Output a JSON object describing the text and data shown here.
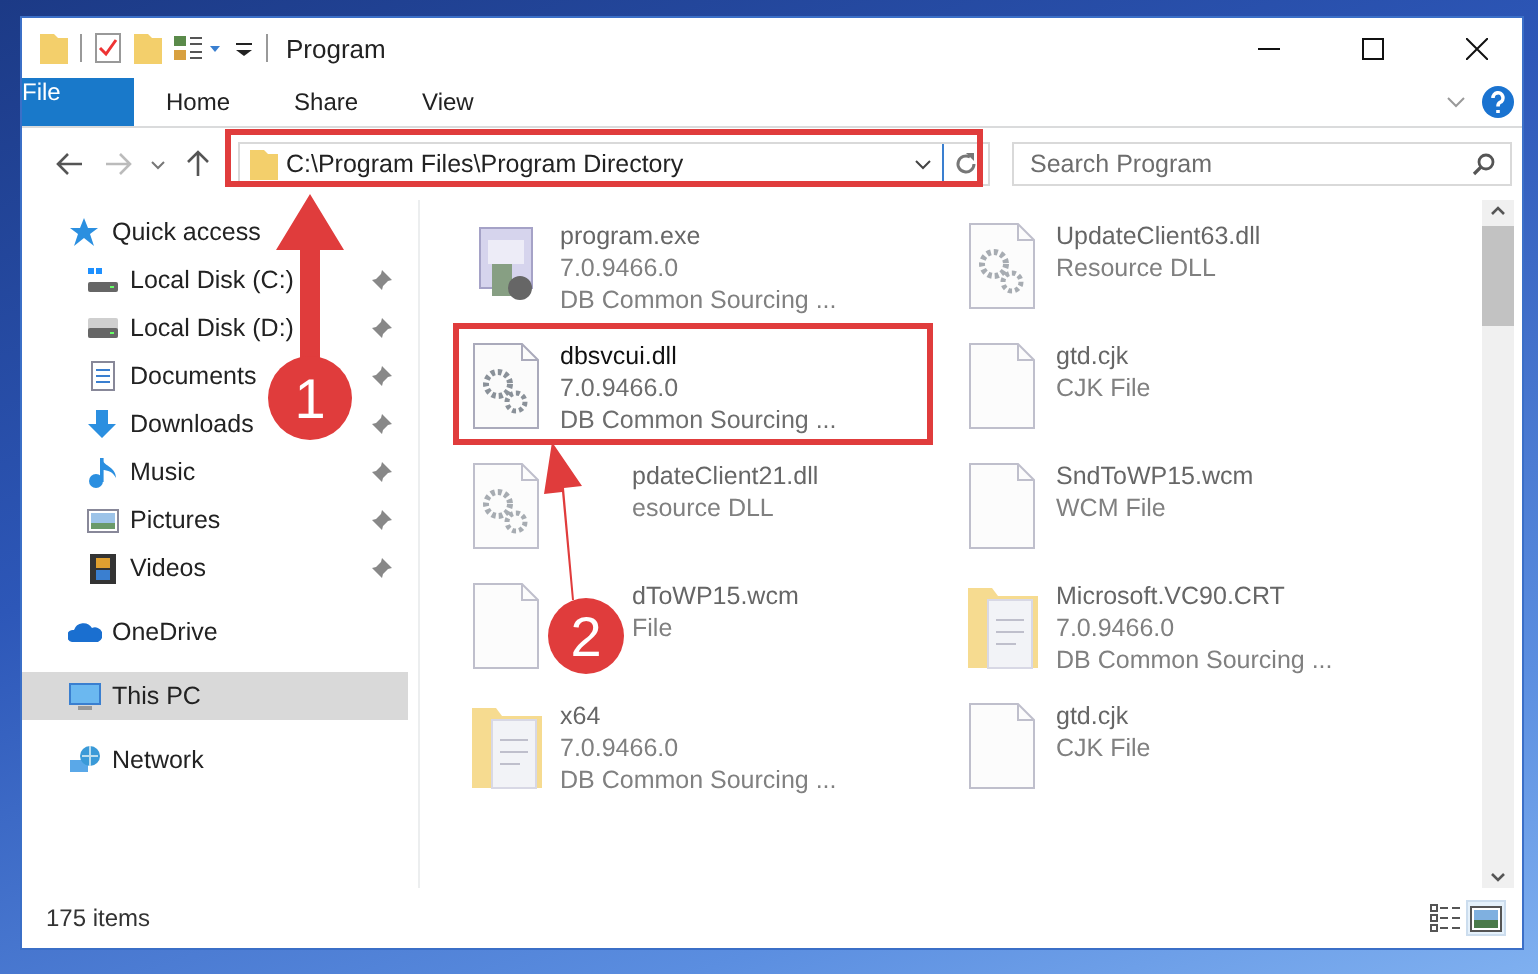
{
  "window": {
    "title": "Program"
  },
  "ribbon": {
    "tabs": [
      {
        "label": "File",
        "kind": "file",
        "selected": false
      },
      {
        "label": "Home",
        "kind": "tab",
        "selected": false
      },
      {
        "label": "Share",
        "kind": "tab",
        "selected": false
      },
      {
        "label": "View",
        "kind": "tab",
        "selected": false
      }
    ]
  },
  "address": {
    "path": "C:\\Program Files\\Program Directory"
  },
  "search": {
    "placeholder": "Search Program"
  },
  "sidebar": {
    "items": [
      {
        "label": "Quick access",
        "kind": "star",
        "selected": false,
        "children": [
          {
            "label": "Local Disk (C:)",
            "kind": "disk-windows",
            "pinned": true,
            "selected": false
          },
          {
            "label": "Local Disk (D:)",
            "kind": "disk",
            "pinned": true,
            "selected": false
          },
          {
            "label": "Documents",
            "kind": "documents",
            "pinned": true,
            "selected": false
          },
          {
            "label": "Downloads",
            "kind": "downloads",
            "pinned": true,
            "selected": false
          },
          {
            "label": "Music",
            "kind": "music",
            "pinned": true,
            "selected": false
          },
          {
            "label": "Pictures",
            "kind": "pictures",
            "pinned": true,
            "selected": false
          },
          {
            "label": "Videos",
            "kind": "videos",
            "pinned": true,
            "selected": false
          }
        ]
      },
      {
        "label": "OneDrive",
        "kind": "cloud",
        "selected": false
      },
      {
        "label": "This PC",
        "kind": "computer",
        "selected": true
      },
      {
        "label": "Network",
        "kind": "network",
        "selected": false
      }
    ]
  },
  "files": [
    {
      "name": "program.exe",
      "details": [
        "7.0.9466.0",
        "DB Common Sourcing ..."
      ],
      "kind": "exe",
      "blurred": true,
      "covered": false
    },
    {
      "name": "UpdateClient63.dll",
      "details": [
        "Resource DLL"
      ],
      "kind": "gear-file",
      "blurred": true,
      "covered": false
    },
    {
      "name": "dbsvcui.dll",
      "details": [
        "7.0.9466.0",
        "DB Common Sourcing ..."
      ],
      "kind": "gear-file",
      "blurred": false,
      "covered": false
    },
    {
      "name": "gtd.cjk",
      "details": [
        "CJK File"
      ],
      "kind": "blank",
      "blurred": true,
      "covered": false
    },
    {
      "name": "pdateClient21.dll",
      "details": [
        "esource DLL"
      ],
      "kind": "gear-file",
      "blurred": true,
      "covered": true
    },
    {
      "name": "SndToWP15.wcm",
      "details": [
        "WCM File"
      ],
      "kind": "blank",
      "blurred": true,
      "covered": false
    },
    {
      "name": "dToWP15.wcm",
      "details": [
        "File"
      ],
      "kind": "blank",
      "blurred": true,
      "covered": true
    },
    {
      "name": "Microsoft.VC90.CRT",
      "details": [
        "7.0.9466.0",
        "DB Common Sourcing ..."
      ],
      "kind": "folder",
      "blurred": true,
      "covered": false
    },
    {
      "name": "x64",
      "details": [
        "7.0.9466.0",
        "DB Common Sourcing ..."
      ],
      "kind": "folder",
      "blurred": true,
      "covered": false
    },
    {
      "name": "gtd.cjk",
      "details": [
        "CJK File"
      ],
      "kind": "blank",
      "blurred": true,
      "covered": false
    }
  ],
  "status_bar": {
    "item_count": "175 items",
    "views": [
      {
        "kind": "details",
        "selected": false
      },
      {
        "kind": "large-icons",
        "selected": true
      }
    ]
  },
  "annotations": {
    "markers": [
      "1",
      "2"
    ]
  }
}
